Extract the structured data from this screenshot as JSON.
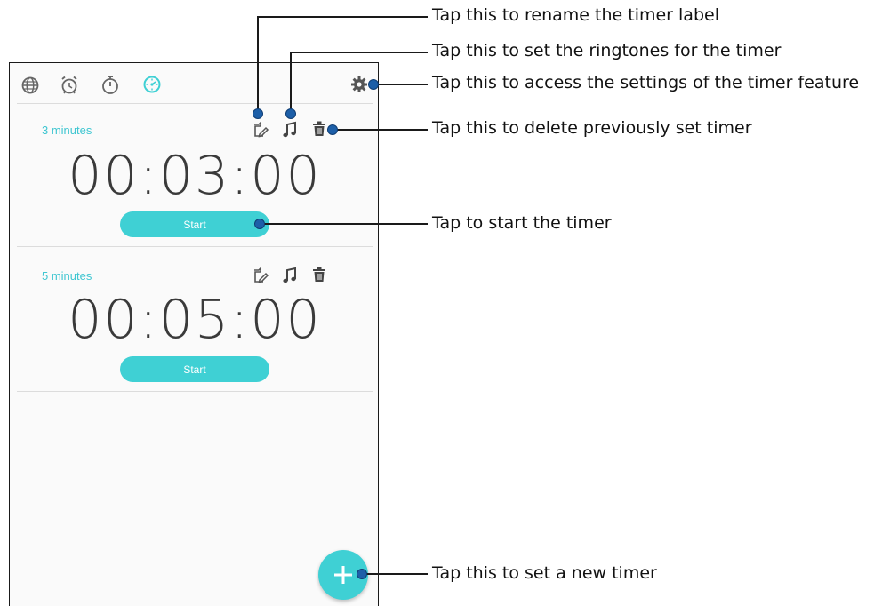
{
  "tabs": [
    {
      "icon": "globe-icon",
      "label": "World clock"
    },
    {
      "icon": "alarm-icon",
      "label": "Alarm"
    },
    {
      "icon": "stopwatch-icon",
      "label": "Stopwatch"
    },
    {
      "icon": "timer-icon",
      "label": "Timer"
    }
  ],
  "active_tab": "Timer",
  "timers": [
    {
      "label": "3 minutes",
      "value": "00:03:00",
      "start_label": "Start"
    },
    {
      "label": "5 minutes",
      "value": "00:05:00",
      "start_label": "Start"
    }
  ],
  "colors": {
    "accent": "#3fd0d4",
    "label": "#3fc6d1",
    "callout_dot": "#1d5fa8"
  },
  "callouts": {
    "rename": "Tap this to rename the timer label",
    "ringtone": "Tap this to set the ringtones for the timer",
    "settings": "Tap this to access the settings of the timer feature",
    "delete": "Tap this to delete previously set timer",
    "start": "Tap to start the timer",
    "add": "Tap this to set a new timer"
  }
}
